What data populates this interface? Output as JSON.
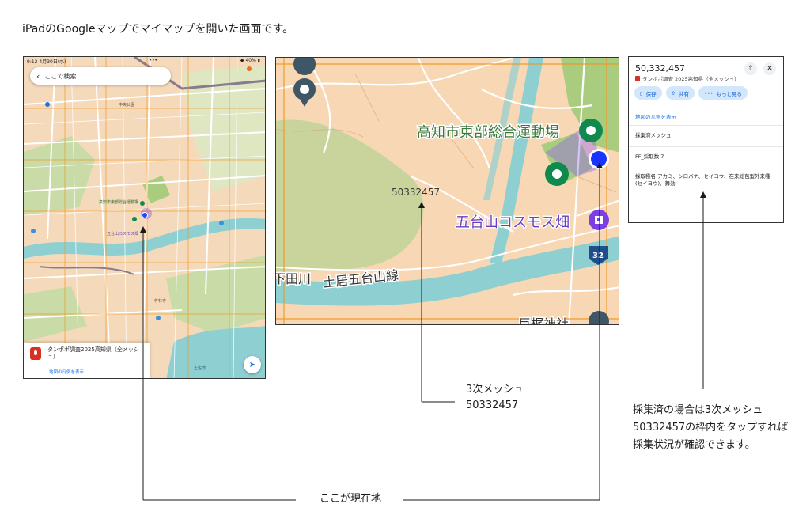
{
  "heading": "iPadのGoogleマップでマイマップを開いた画面です。",
  "ipad": {
    "status_time": "9:12  4月30日(水)",
    "status_dots": "•••",
    "status_right": "◆ 40% ▮",
    "search_placeholder": "ここで検索",
    "map_labels": [
      "中央公園",
      "高知市東部総合運動場",
      "五台山コスモス畑",
      "竹林寺",
      "土佐湾"
    ],
    "sheet_title": "タンポポ調査2025高知県（全メッシュ）",
    "sheet_legend": "地図の凡例を表示"
  },
  "zoom": {
    "label_park": "高知市東部総合運動場",
    "label_mesh": "50332457",
    "label_cosmos": "五台山コスモス畑",
    "label_road": "土居五台山線",
    "label_river": "下田川",
    "label_shrine": "巨梶神社",
    "route_number": "32"
  },
  "card": {
    "number": "50,332,457",
    "subtitle": "タンポポ調査 2025高知県（全メッシュ）",
    "btn_save": "保存",
    "btn_share": "共有",
    "btn_more": "もっと見る",
    "legend_link": "地図の凡例を表示",
    "row1": "採集済メッシュ",
    "row2": "FF_採取数  7",
    "row3": "採取種名  アカミ、シロバナ、セイヨウ、在来総苞型外来種(セイヨウ)、舞効"
  },
  "annotations": {
    "mesh_line1": "3次メッシュ",
    "mesh_line2": "50332457",
    "current_location": "ここが現在地",
    "note": "採集済の場合は3次メッシュ50332457の枠内をタップすれば採集状況が確認できます。"
  },
  "colors": {
    "land": "#f7d7b4",
    "green": "#bcd39a",
    "water": "#8ecfd2",
    "road": "#ffffff",
    "grid": "#f0961e",
    "accent_blue": "#1a73e8",
    "pin_green": "#0f8a4f"
  }
}
